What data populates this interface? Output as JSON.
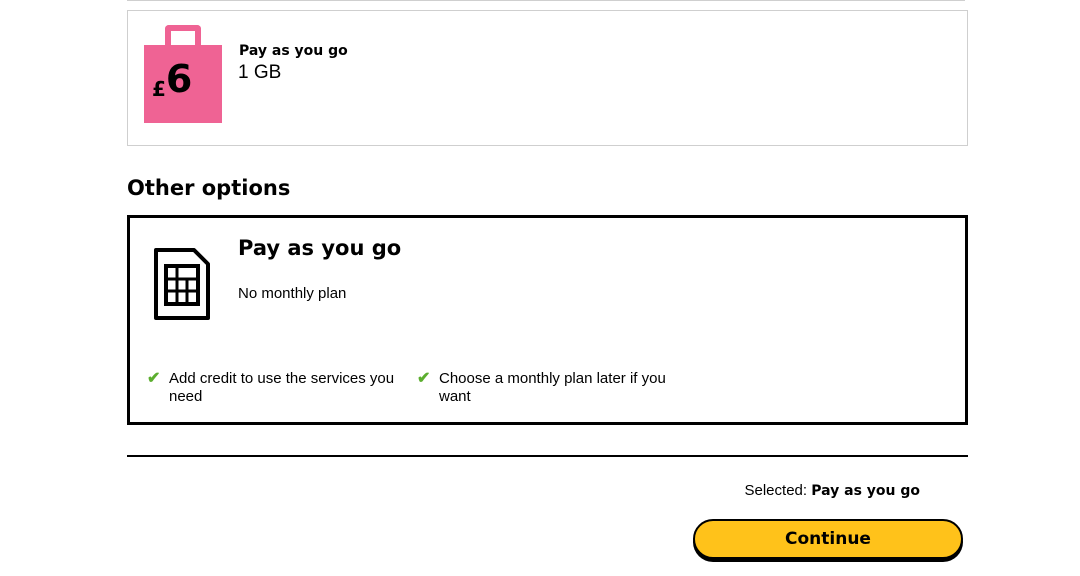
{
  "bundle": {
    "currency": "£",
    "price": "6",
    "name": "Pay as you go",
    "data": "1 GB"
  },
  "other_options": {
    "title": "Other options",
    "option": {
      "title": "Pay as you go",
      "subtitle": "No monthly plan",
      "features": [
        "Add credit to use the services you need",
        "Choose a monthly plan later if you want"
      ]
    }
  },
  "footer": {
    "selected_label": "Selected:",
    "selected_value": "Pay as you go",
    "continue_label": "Continue"
  },
  "colors": {
    "bag": "#ef6394",
    "check": "#5cae2f",
    "button": "#ffc21a"
  },
  "icons": {
    "bundle": "shopping-bag-icon",
    "option": "sim-card-icon",
    "feature": "check-icon"
  }
}
